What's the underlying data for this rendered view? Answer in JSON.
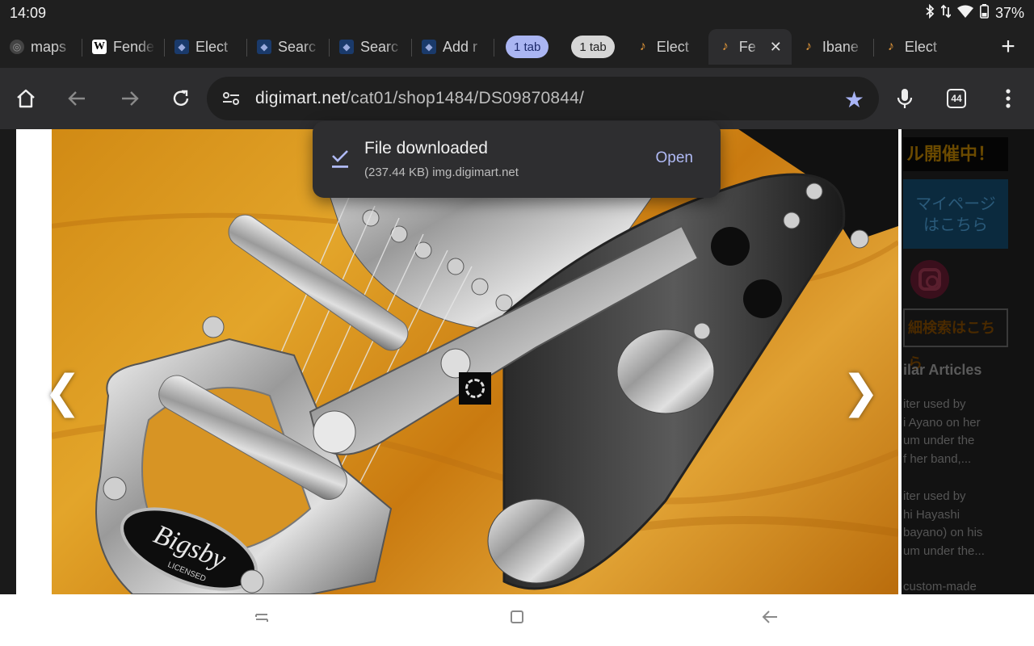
{
  "status": {
    "time": "14:09",
    "battery": "37%",
    "icons": [
      "bluetooth-icon",
      "data-arrows-icon",
      "wifi-icon",
      "battery-icon"
    ]
  },
  "tabs": [
    {
      "title": "maps",
      "favicon": "maps-icon",
      "state": "normal"
    },
    {
      "title": "Fende",
      "favicon": "wikipedia-icon",
      "state": "normal"
    },
    {
      "title": "Elect",
      "favicon": "digimart-icon",
      "state": "normal"
    },
    {
      "title": "Searc",
      "favicon": "digimart-icon",
      "state": "normal"
    },
    {
      "title": "Searc",
      "favicon": "digimart-icon",
      "state": "normal"
    },
    {
      "title": "Add r",
      "favicon": "digimart-icon",
      "state": "normal"
    },
    {
      "title": "1 tab",
      "favicon": "",
      "state": "group-blue"
    },
    {
      "title": "1 tab",
      "favicon": "",
      "state": "group-gray"
    },
    {
      "title": "Elect",
      "favicon": "guitar-icon",
      "state": "normal"
    },
    {
      "title": "Fe",
      "favicon": "guitar-icon",
      "state": "active"
    },
    {
      "title": "Ibane",
      "favicon": "guitar-icon",
      "state": "normal"
    },
    {
      "title": "Elect",
      "favicon": "guitar-icon",
      "state": "normal"
    }
  ],
  "toolbar": {
    "url_domain": "digimart.net",
    "url_path": "/cat01/shop1484/DS09870844/",
    "tab_count": "44"
  },
  "sidebar": {
    "banner_text": "ル開催中！",
    "mypage_line1": "マイページ",
    "mypage_line2": "はこちら",
    "search_text": "細検索はこちら",
    "popular_title": "ilar Articles",
    "articles": [
      [
        "iter used by",
        "i Ayano on her",
        "um under the",
        "f her band,..."
      ],
      [
        "iter used by",
        "hi Hayashi",
        "bayano) on his",
        "um under the..."
      ],
      [
        "custom-made"
      ]
    ]
  },
  "product": {
    "logo_text": "Bigsby",
    "logo_sub": "LICENSED"
  },
  "toast": {
    "title": "File downloaded",
    "detail": "(237.44 KB) img.digimart.net",
    "action": "Open"
  },
  "colors": {
    "accent": "#a8b4f6",
    "toast_bg": "#2e2e30",
    "toolbar_bg": "#2d2d2f"
  }
}
